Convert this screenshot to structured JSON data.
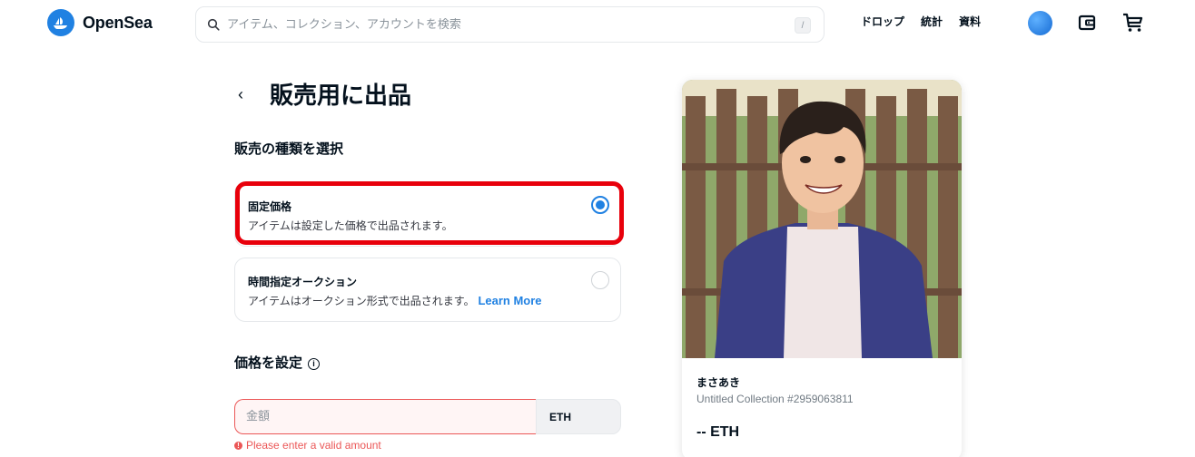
{
  "header": {
    "brand": "OpenSea",
    "search_placeholder": "アイテム、コレクション、アカウントを検索",
    "search_shortcut": "/",
    "nav": [
      "ドロップ",
      "統計",
      "資料"
    ],
    "icons": [
      "opensea-logo-icon",
      "search-icon",
      "profile-avatar",
      "wallet-icon",
      "cart-icon"
    ]
  },
  "main": {
    "back_icon": "chevron-left-icon",
    "title": "販売用に出品",
    "sale_type_label": "販売の種類を選択",
    "options": [
      {
        "title": "固定価格",
        "description": "アイテムは設定した価格で出品されます。",
        "link": "",
        "selected": true
      },
      {
        "title": "時間指定オークション",
        "description": "アイテムはオークション形式で出品されます。",
        "link": "Learn More",
        "selected": false
      }
    ],
    "price_label": "価格を設定",
    "price_info_icon": "i",
    "price_placeholder": "金額",
    "price_value": "",
    "currency": "ETH",
    "error_icon": "!",
    "error_text": "Please enter a valid amount"
  },
  "preview": {
    "name": "まさあき",
    "collection": "Untitled Collection #2959063811",
    "price": "-- ETH"
  },
  "colors": {
    "accent": "#2081e2",
    "highlight": "#e8000b",
    "error": "#eb5757"
  }
}
